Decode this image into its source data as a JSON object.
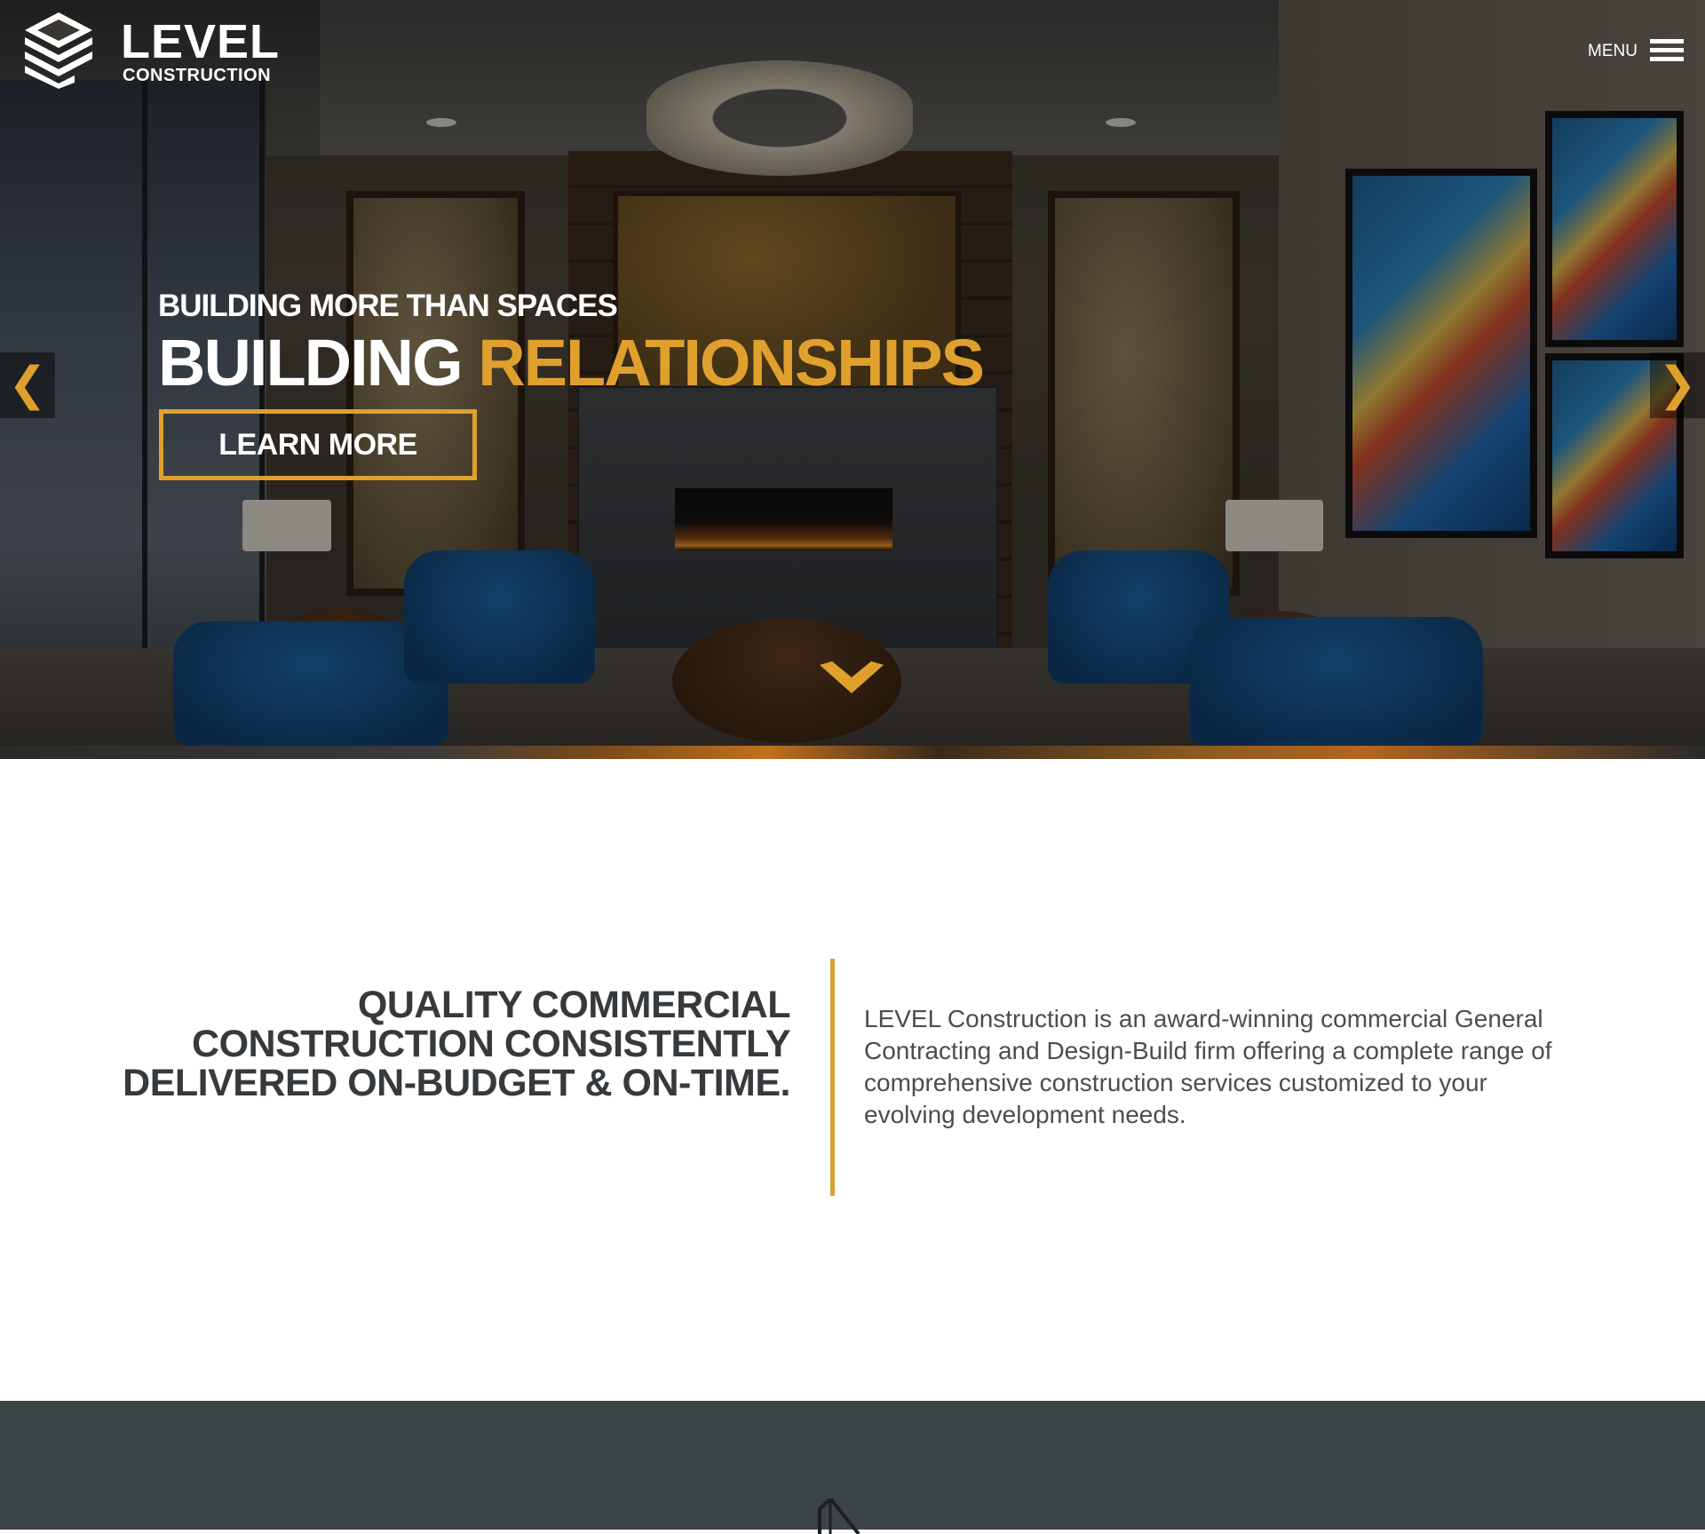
{
  "brand": {
    "wordmark": "LEVEL",
    "subtitle": "CONSTRUCTION",
    "accent_color": "#e0a02d",
    "dark_color": "#3d4447"
  },
  "header": {
    "menu_label": "MENU",
    "menu_icon": "hamburger-icon"
  },
  "hero": {
    "kicker": "BUILDING MORE THAN SPACES",
    "headline_word1": "BUILDING",
    "headline_word2": "RELATIONSHIPS",
    "cta_label": "LEARN MORE",
    "prev_arrow": "❮",
    "next_arrow": "❯",
    "scroll_icon": "chevron-down-icon"
  },
  "intro": {
    "heading": "QUALITY COMMERCIAL CONSTRUCTION CONSISTENTLY DELIVERED ON-BUDGET & ON-TIME.",
    "body": "LEVEL Construction is an award-winning commercial General Contracting and Design-Build firm offering a complete range of comprehensive construction services customized to your evolving development needs."
  }
}
